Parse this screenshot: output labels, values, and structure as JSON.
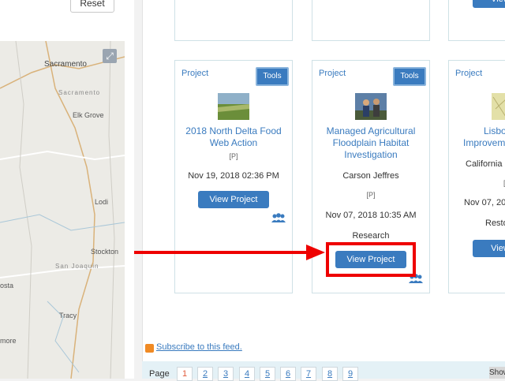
{
  "sidebar": {
    "reset_label": "Reset",
    "map": {
      "labels": [
        "Sacramento",
        "Sacramento",
        "Elk Grove",
        "Lodi",
        "Stockton",
        "San Joaquin",
        "Tracy",
        "osta",
        "more"
      ],
      "expand_icon": "expand-icon"
    }
  },
  "cards": [
    {
      "type": "Project",
      "tools_label": "Tools",
      "title": "2018 North Delta Food Web Action",
      "privacy": "[P]",
      "date": "Nov 19, 2018 02:36 PM",
      "view_label": "View Project"
    },
    {
      "type": "Project",
      "tools_label": "Tools",
      "title": "Managed Agricultural Floodplain Habitat Investigation",
      "person": "Carson Jeffres",
      "privacy": "[P]",
      "date": "Nov 07, 2018 10:35 AM",
      "category": "Research",
      "view_label": "View Project"
    },
    {
      "type": "Project",
      "title_line1": "Lisbo",
      "title_line2": "Improveme",
      "org": "California",
      "privacy": "[",
      "date": "Nov 07, 20",
      "category": "Resto",
      "view_label": "View"
    }
  ],
  "top_partial_view_label": "View",
  "feed": {
    "subscribe_label": "Subscribe to this feed.",
    "icon": "rss-icon"
  },
  "pager": {
    "label": "Page",
    "pages": [
      "1",
      "2",
      "3",
      "4",
      "5",
      "6",
      "7",
      "8",
      "9"
    ],
    "show_label": "Show"
  },
  "colors": {
    "accent": "#3a7bbf",
    "highlight": "#e00000"
  }
}
